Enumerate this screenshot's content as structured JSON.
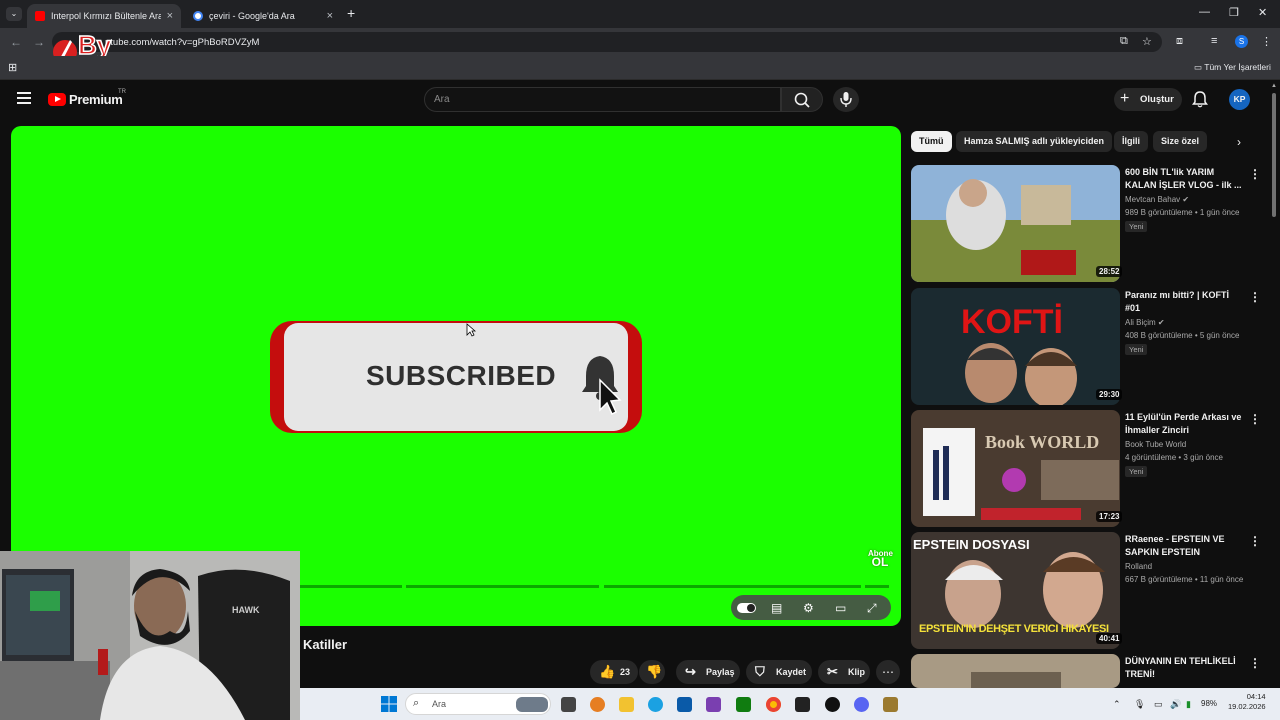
{
  "browser": {
    "tabs": [
      {
        "title": "Interpol Kırmızı Bültenle Aranan",
        "active": true
      },
      {
        "title": "çeviri - Google'da Ara",
        "active": false
      }
    ],
    "url": "utube.com/watch?v=gPhBoRDVZyM",
    "profile_initial": "S",
    "bookmarks_all": "Tüm Yer İşaretleri",
    "overlay_logo": "By"
  },
  "header": {
    "logo": "Premium",
    "country": "TR",
    "search_placeholder": "Ara",
    "create_label": "Oluştur",
    "avatar_initials": "KP"
  },
  "player": {
    "subscribe_text": "SUBSCRIBED",
    "abone_line1": "Abone",
    "abone_line2": "OL"
  },
  "video": {
    "title_visible": "Katiller",
    "likes": "23",
    "share_label": "Paylaş",
    "save_label": "Kaydet",
    "clip_label": "Klip"
  },
  "chips": [
    "Tümü",
    "Hamza SALMIŞ adlı yükleyiciden",
    "İlgili",
    "Size özel"
  ],
  "recommendations": [
    {
      "title": "600 BİN TL'lik YARIM KALAN İŞLER VLOG - ilk ...",
      "channel": "Mevtcan Bahav",
      "verified": true,
      "meta": "989 B görüntüleme • 1 gün önce",
      "badge": "Yeni",
      "duration": "28:52"
    },
    {
      "title": "Paranız mı bitti? | KOFTİ #01",
      "channel": "Ali Biçim",
      "verified": true,
      "meta": "408 B görüntüleme • 5 gün önce",
      "badge": "Yeni",
      "duration": "29:30",
      "thumb_text": "KOFTİ"
    },
    {
      "title": "11 Eylül'ün Perde Arkası ve İhmaller Zinciri",
      "channel": "Book Tube World",
      "verified": false,
      "meta": "4 görüntüleme • 3 gün önce",
      "badge": "Yeni",
      "duration": "17:23",
      "thumb_text": "Book WORLD"
    },
    {
      "title": "RRaenee - EPSTEIN VE SAPKIN EPSTEIN ADASINI...",
      "channel": "Rolland",
      "verified": false,
      "meta": "667 B görüntüleme • 11 gün önce",
      "badge": "",
      "duration": "40:41",
      "thumb_text_top": "EPSTEIN DOSYASI",
      "thumb_text_bottom": "EPSTEIN'IN DEHŞET VERICI HIKAYESI"
    },
    {
      "title": "DÜNYANIN EN TEHLİKELİ TRENİ!",
      "channel": "",
      "verified": false,
      "meta": "",
      "badge": "",
      "duration": ""
    }
  ],
  "taskbar": {
    "search_placeholder": "Ara",
    "battery": "98%",
    "time": "04:14",
    "date": "19.02.2026"
  },
  "colors": {
    "player_bg": "#1bff00",
    "subscribe_red": "#c40d0d",
    "yt_red": "#ff0000",
    "avatar_blue": "#1565c0"
  }
}
